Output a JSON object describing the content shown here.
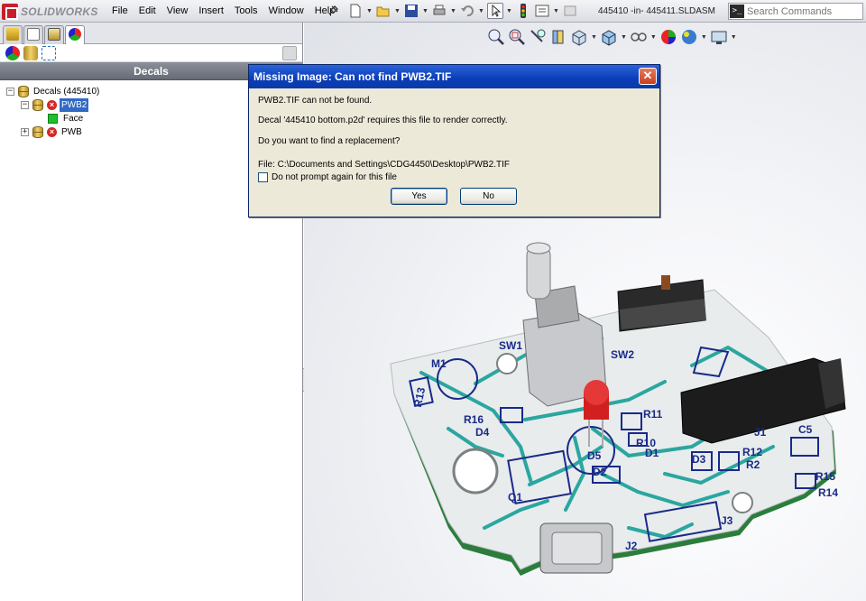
{
  "app": {
    "logo_text": "SOLIDWORKS",
    "document_title": "445410 -in- 445411.SLDASM"
  },
  "menu": {
    "items": [
      "File",
      "Edit",
      "View",
      "Insert",
      "Tools",
      "Window",
      "Help"
    ]
  },
  "search": {
    "placeholder": "Search Commands"
  },
  "panel": {
    "title": "Decals",
    "tree": {
      "root_label": "Decals (445410)",
      "children": [
        {
          "label": "PWB2",
          "status": "error",
          "selected": true,
          "children": [
            {
              "label": "Face"
            }
          ]
        },
        {
          "label": "PWB",
          "status": "error",
          "selected": false
        }
      ]
    }
  },
  "dialog": {
    "title": "Missing Image: Can not find PWB2.TIF",
    "line1": "PWB2.TIF can not be found.",
    "line2": "Decal '445410 bottom.p2d' requires this file to render correctly.",
    "line3": "Do you want to find a replacement?",
    "file_line": "File:  C:\\Documents and Settings\\CDG4450\\Desktop\\PWB2.TIF",
    "checkbox_label": "Do not prompt again for this file",
    "checkbox_checked": false,
    "yes_label": "Yes",
    "no_label": "No"
  },
  "model": {
    "labels": {
      "M1": "M1",
      "SW1": "SW1",
      "SW2": "SW2",
      "R13": "R13",
      "R16": "R16",
      "D4": "D4",
      "R11": "R11",
      "R10": "R10",
      "D1": "D1",
      "D5": "D5",
      "D2": "D2",
      "J1": "J1",
      "C5": "C5",
      "D3": "D3",
      "R12": "R12",
      "R2": "R2",
      "R15": "R15",
      "R14": "R14",
      "Q1": "Q1",
      "J3": "J3",
      "J2": "J2"
    }
  },
  "colors": {
    "pcb_green": "#2b7d3c",
    "pcb_silk": "#e8ecec",
    "trace": "#2ba6a0",
    "silk_lines": "#1a2a8a",
    "dialog_title": "#0a3db8"
  }
}
